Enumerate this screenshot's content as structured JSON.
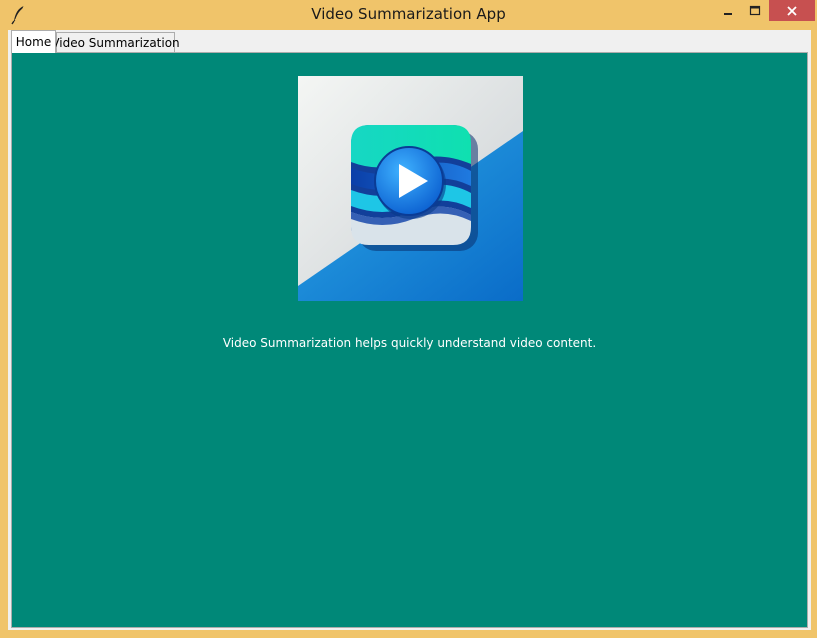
{
  "window": {
    "title": "Video Summarization App",
    "app_icon": "feather-icon",
    "controls": {
      "minimize": "minimize-icon",
      "maximize": "maximize-icon",
      "close": "close-icon"
    },
    "colors": {
      "frame": "#f0c46a",
      "close_button": "#c75050"
    }
  },
  "tabs": [
    {
      "label": "Home",
      "active": true
    },
    {
      "label": "Video Summarization",
      "active": false
    }
  ],
  "home": {
    "logo": "video-play-logo",
    "description": "Video Summarization helps quickly understand video content.",
    "background": "#008878"
  }
}
